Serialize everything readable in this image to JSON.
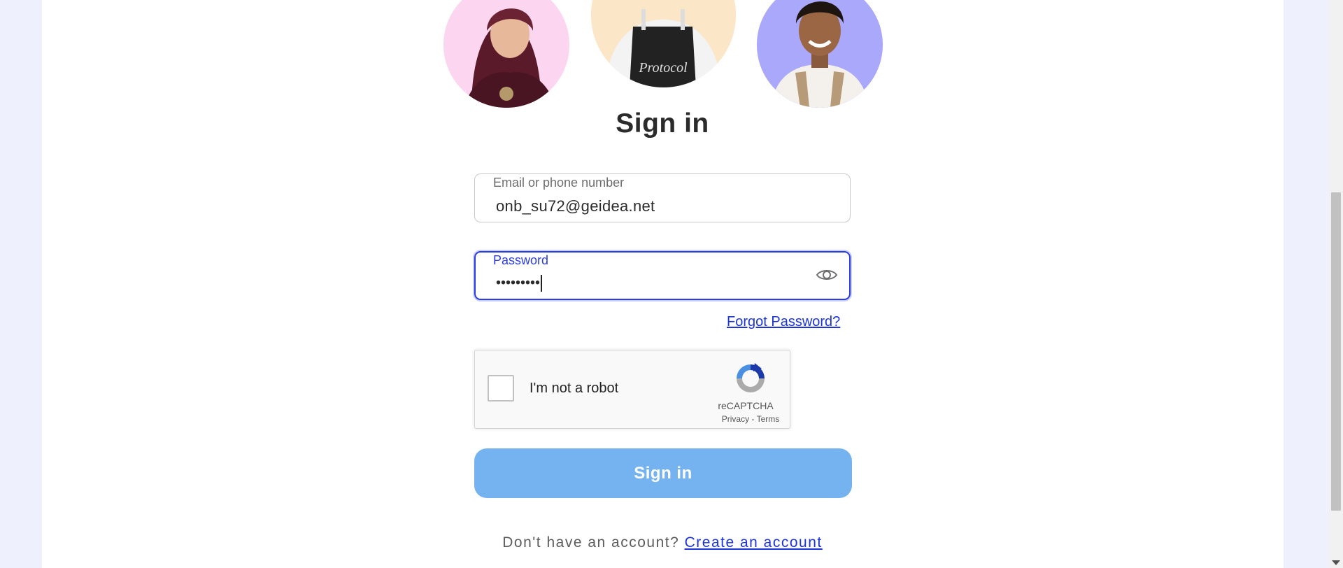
{
  "page": {
    "title": "Sign in"
  },
  "avatars": [
    {
      "name": "avatar-woman",
      "bg": "#fcd6f0"
    },
    {
      "name": "avatar-apron-man",
      "bg": "#fbe6c8"
    },
    {
      "name": "avatar-smiling-man",
      "bg": "#a9a8fb"
    }
  ],
  "email": {
    "label": "Email or phone number",
    "value": "onb_su72@geidea.net"
  },
  "password": {
    "label": "Password",
    "value": "•••••••••",
    "toggle_icon": "eye-icon"
  },
  "forgot_password": "Forgot Password?",
  "recaptcha": {
    "label": "I'm not a robot",
    "brand": "reCAPTCHA",
    "privacy": "Privacy",
    "separator": " - ",
    "terms": "Terms"
  },
  "submit_label": "Sign in",
  "footer": {
    "prompt": "Don't have an account?",
    "link": "Create an account"
  },
  "colors": {
    "accent": "#2b3de0",
    "link": "#1d35d8",
    "button": "#74b3f0",
    "background": "#eef1fd"
  }
}
